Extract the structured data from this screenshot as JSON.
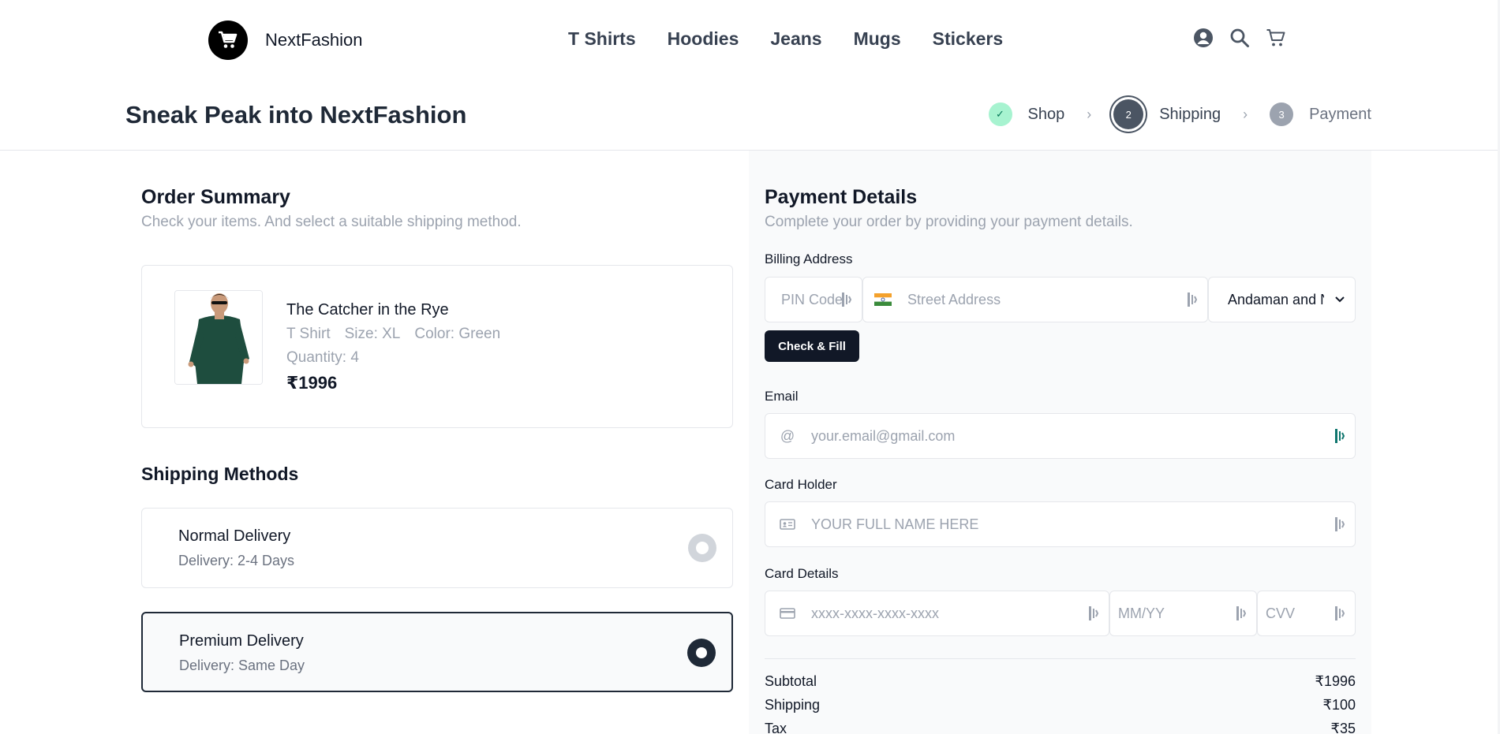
{
  "brand": {
    "name": "NextFashion"
  },
  "nav": {
    "items": [
      "T Shirts",
      "Hoodies",
      "Jeans",
      "Mugs",
      "Stickers"
    ]
  },
  "header_icons": [
    "user-icon",
    "search-icon",
    "cart-icon"
  ],
  "page": {
    "title": "Sneak Peak into NextFashion"
  },
  "steps": [
    {
      "label": "Shop",
      "state": "done",
      "marker": "✓"
    },
    {
      "label": "Shipping",
      "state": "active",
      "marker": "2"
    },
    {
      "label": "Payment",
      "state": "pending",
      "marker": "3"
    }
  ],
  "order_summary": {
    "title": "Order Summary",
    "subtitle": "Check your items. And select a suitable shipping method.",
    "item": {
      "name": "The Catcher in the Rye",
      "category": "T Shirt",
      "size": "Size: XL",
      "color": "Color: Green",
      "quantity": "Quantity: 4",
      "price": "₹1996"
    }
  },
  "shipping": {
    "title": "Shipping Methods",
    "options": [
      {
        "name": "Normal Delivery",
        "desc": "Delivery: 2-4 Days",
        "selected": false
      },
      {
        "name": "Premium Delivery",
        "desc": "Delivery: Same Day",
        "selected": true
      }
    ]
  },
  "payment": {
    "title": "Payment Details",
    "subtitle": "Complete your order by providing your payment details.",
    "billing_label": "Billing Address",
    "pin_placeholder": "PIN Code",
    "street_placeholder": "Street Address",
    "state_value": "Andaman and Nicobar",
    "check_fill_label": "Check & Fill",
    "email_label": "Email",
    "email_placeholder": "your.email@gmail.com",
    "card_holder_label": "Card Holder",
    "card_holder_placeholder": "YOUR FULL NAME HERE",
    "card_details_label": "Card Details",
    "card_number_placeholder": "xxxx-xxxx-xxxx-xxxx",
    "expiry_placeholder": "MM/YY",
    "cvv_placeholder": "CVV"
  },
  "totals": {
    "subtotal_label": "Subtotal",
    "subtotal_value": "₹1996",
    "shipping_label": "Shipping",
    "shipping_value": "₹100",
    "tax_label": "Tax",
    "tax_value": "₹35"
  },
  "colors": {
    "accent_dark": "#111827",
    "step_done": "#a7f3d0",
    "muted": "#9ca3af"
  }
}
